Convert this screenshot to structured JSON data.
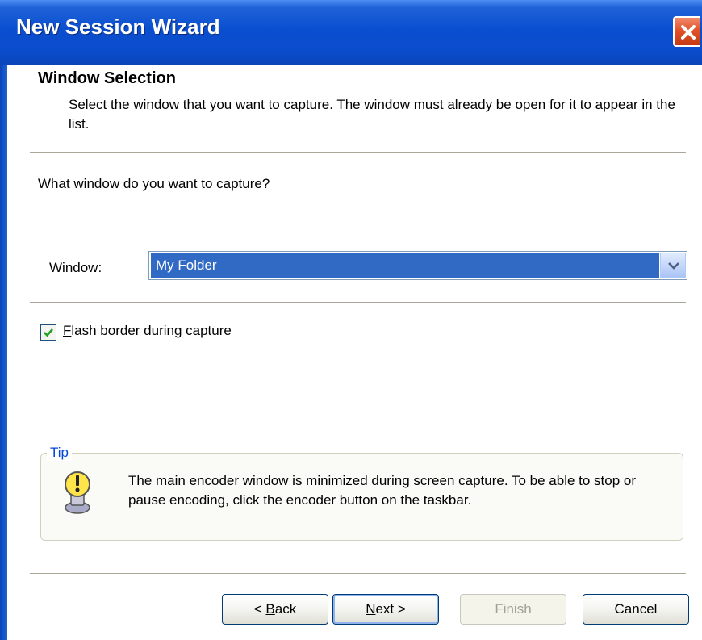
{
  "window": {
    "title": "New Session Wizard"
  },
  "header": {
    "title": "Window Selection",
    "description": "Select the window that you want to capture. The window must already be open for it to appear in the list."
  },
  "question": "What window do you want to capture?",
  "window_select": {
    "label": "Window:",
    "value": "My Folder"
  },
  "flash_border": {
    "checked": true,
    "label_underlined_char": "F",
    "label_rest": "lash border during capture"
  },
  "tip": {
    "legend": "Tip",
    "text": "The main encoder window is minimized during screen capture. To be able to stop or pause encoding, click the encoder button on the taskbar."
  },
  "buttons": {
    "back_prefix": "< ",
    "back_underlined": "B",
    "back_rest": "ack",
    "next_underlined": "N",
    "next_rest": "ext >",
    "finish": "Finish",
    "cancel": "Cancel"
  },
  "colors": {
    "titlebar": "#0a4fd0",
    "selection": "#316ac5",
    "close_button": "#e2522a",
    "tip_legend": "#0046d5"
  },
  "icons": {
    "close": "close-icon",
    "dropdown": "chevron-down-icon",
    "checkbox": "checkmark-icon",
    "tip": "lightbulb-warning-icon"
  }
}
